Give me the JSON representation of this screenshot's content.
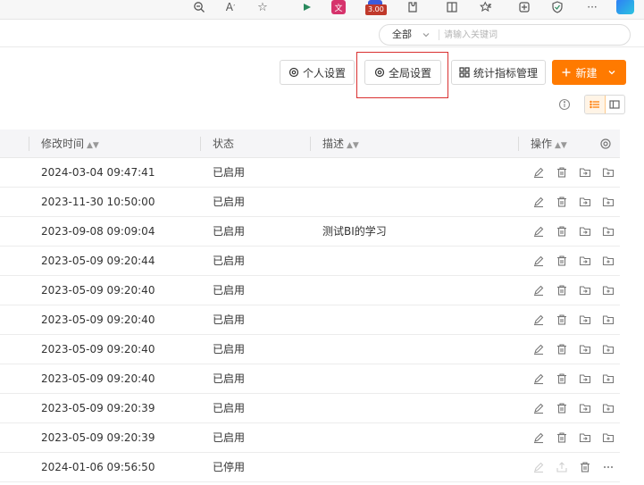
{
  "browser": {
    "icons": [
      "zoom-out-icon",
      "read-aloud-icon",
      "favorite-icon",
      "extension-icon",
      "translate-icon",
      "extension-badge-icon",
      "extensions-icon",
      "split-screen-icon",
      "favorites-icon",
      "collections-icon",
      "browser-essentials-icon",
      "more-icon",
      "copilot-icon"
    ],
    "badge_text": "3.00"
  },
  "search": {
    "scope": "全部",
    "placeholder": "请输入关键词"
  },
  "toolbar": {
    "personal_settings": "个人设置",
    "global_settings": "全局设置",
    "metrics_management": "统计指标管理",
    "new_label": "新建"
  },
  "colors": {
    "accent": "#ff7a00",
    "highlight_border": "#d93030"
  },
  "table": {
    "columns": {
      "modified_time": "修改时间",
      "status": "状态",
      "description": "描述",
      "actions": "操作"
    },
    "rows": [
      {
        "time": "2024-03-04 09:47:41",
        "status": "已启用",
        "desc": "",
        "enabled": true
      },
      {
        "time": "2023-11-30 10:50:00",
        "status": "已启用",
        "desc": "",
        "enabled": true
      },
      {
        "time": "2023-09-08 09:09:04",
        "status": "已启用",
        "desc": "测试BI的学习",
        "enabled": true
      },
      {
        "time": "2023-05-09 09:20:44",
        "status": "已启用",
        "desc": "",
        "enabled": true
      },
      {
        "time": "2023-05-09 09:20:40",
        "status": "已启用",
        "desc": "",
        "enabled": true
      },
      {
        "time": "2023-05-09 09:20:40",
        "status": "已启用",
        "desc": "",
        "enabled": true
      },
      {
        "time": "2023-05-09 09:20:40",
        "status": "已启用",
        "desc": "",
        "enabled": true
      },
      {
        "time": "2023-05-09 09:20:40",
        "status": "已启用",
        "desc": "",
        "enabled": true
      },
      {
        "time": "2023-05-09 09:20:39",
        "status": "已启用",
        "desc": "",
        "enabled": true
      },
      {
        "time": "2023-05-09 09:20:39",
        "status": "已启用",
        "desc": "",
        "enabled": true
      },
      {
        "time": "2024-01-06 09:56:50",
        "status": "已停用",
        "desc": "",
        "enabled": false
      }
    ]
  }
}
